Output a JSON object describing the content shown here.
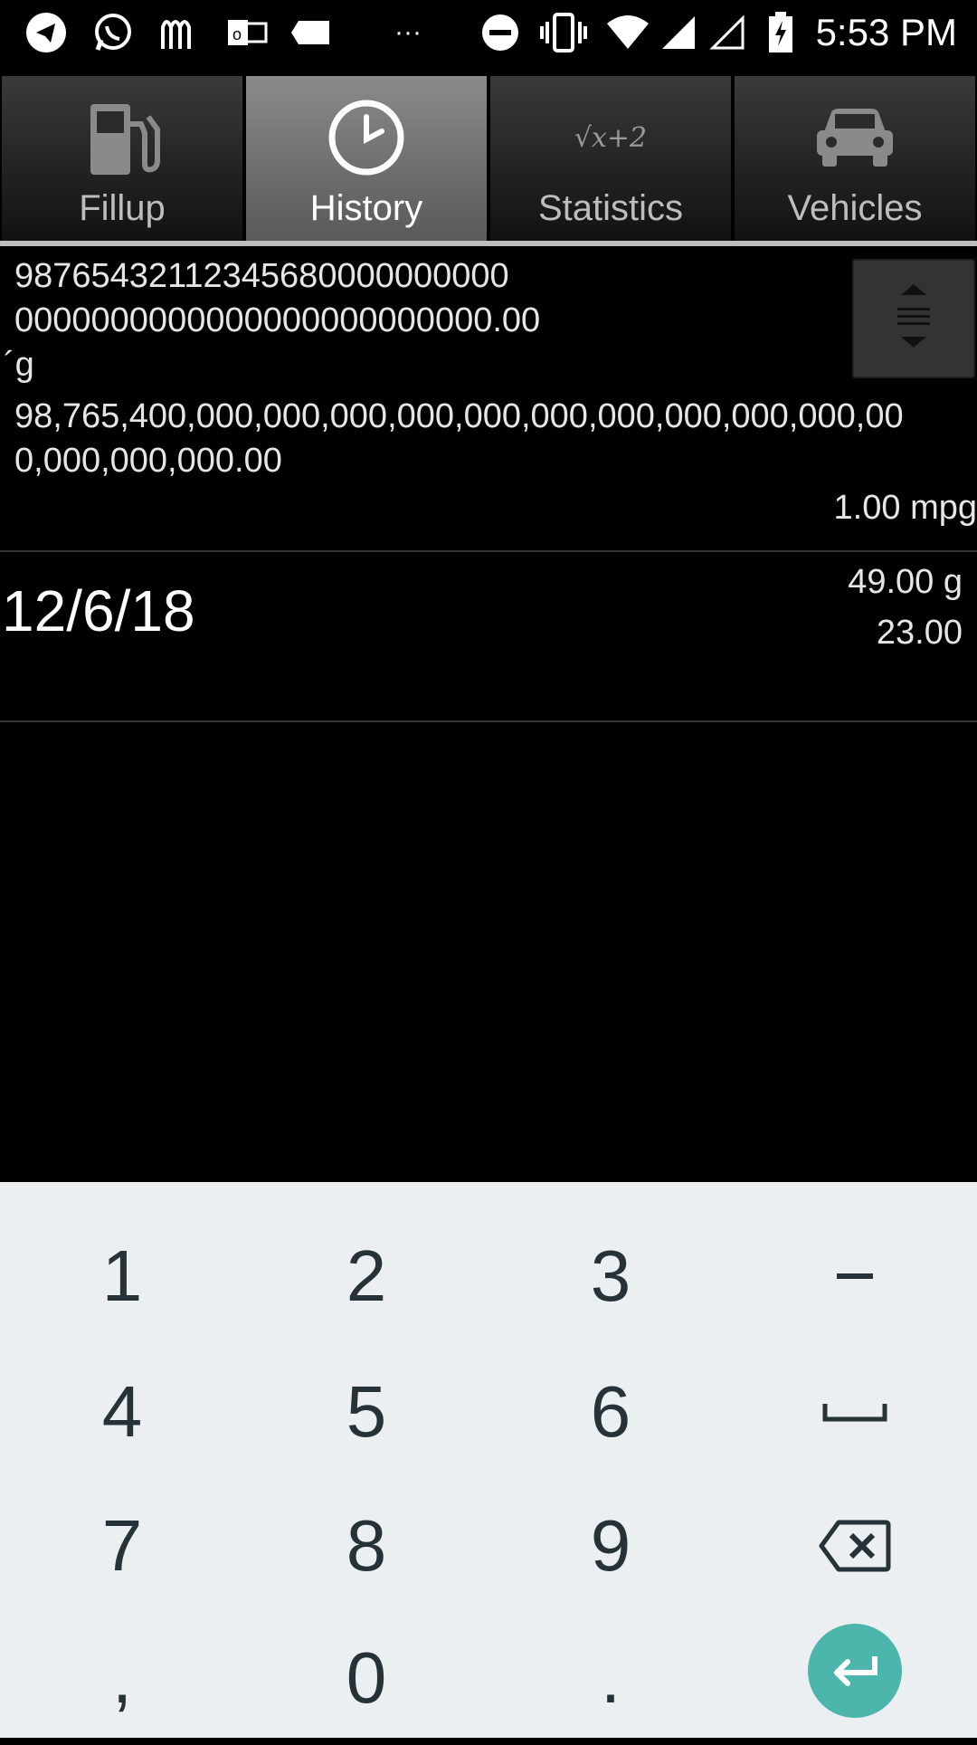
{
  "status_bar": {
    "time": "5:53 PM",
    "icons": [
      "telegram-icon",
      "whatsapp-icon",
      "mcdonalds-icon",
      "outlook-icon",
      "label-icon",
      "more-dots-icon",
      "dnd-icon",
      "vibrate-icon",
      "wifi-icon",
      "signal-icon",
      "signal-empty-icon",
      "battery-charging-icon"
    ]
  },
  "tabs": [
    {
      "label": "Fillup",
      "icon": "fuel-pump-icon",
      "active": false
    },
    {
      "label": "History",
      "icon": "clock-icon",
      "active": true
    },
    {
      "label": "Statistics",
      "icon": "formula-icon",
      "active": false,
      "icon_text": "√x+2"
    },
    {
      "label": "Vehicles",
      "icon": "car-icon",
      "active": false
    }
  ],
  "history": {
    "entries": [
      {
        "lines": [
          "98765432112345680000000000",
          "0000000000000000000000000.00",
          "´g",
          "98,765,400,000,000,000,000,000,000,000,000,000,000,00",
          "0,000,000,000.00"
        ],
        "efficiency": "1.00 mpg"
      },
      {
        "date": "12/6/18",
        "gallons": "49.00 g",
        "price": "23.00"
      }
    ]
  },
  "keyboard": {
    "row1": [
      "1",
      "2",
      "3",
      "-"
    ],
    "row2": [
      "4",
      "5",
      "6",
      "space"
    ],
    "row3": [
      "7",
      "8",
      "9",
      "backspace"
    ],
    "row4": [
      ",",
      "0",
      ".",
      "enter"
    ],
    "accent_color": "#4db6ac"
  }
}
